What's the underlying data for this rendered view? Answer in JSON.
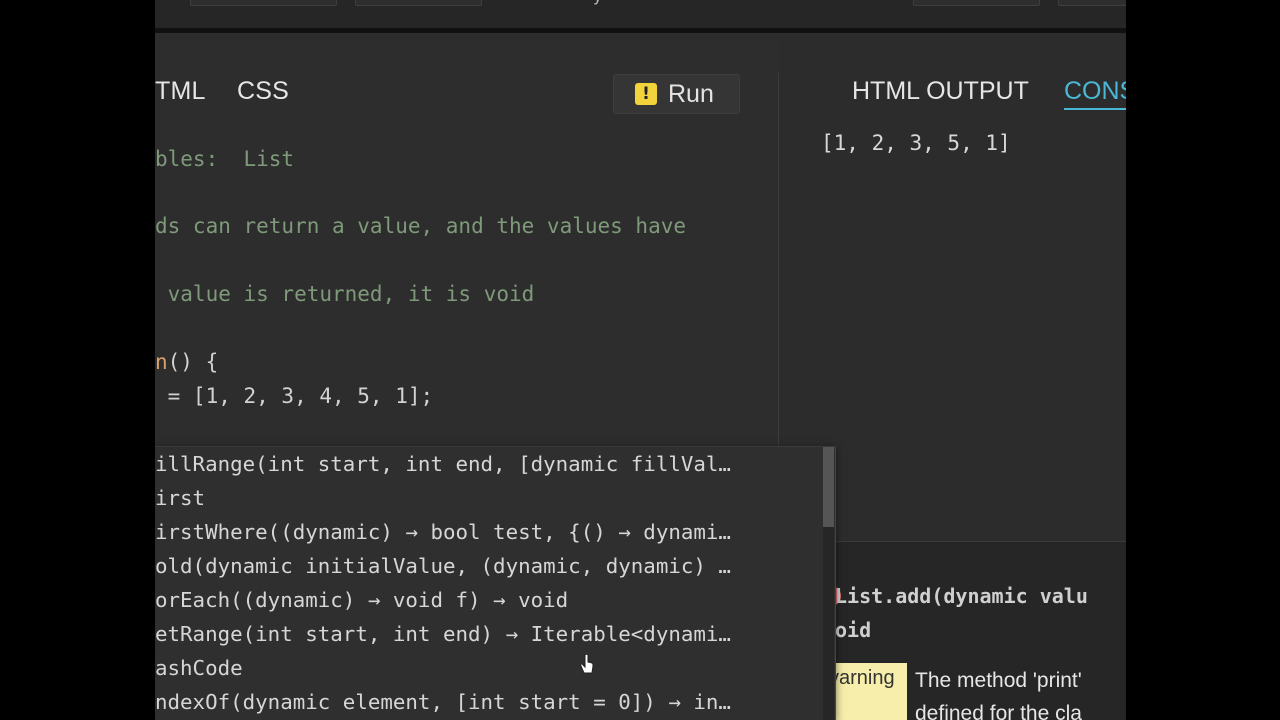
{
  "top_bar": {
    "partial_text": "y"
  },
  "editor": {
    "tabs": [
      "TML",
      "CSS"
    ],
    "run_label": "Run",
    "run_icon": "warning-exclamation-icon",
    "lines": [
      {
        "text": "bles:  List",
        "kind": "comment"
      },
      {
        "text": "ds can return a value, and the values have",
        "kind": "comment"
      },
      {
        "text": " value is returned, it is void",
        "kind": "comment"
      },
      {
        "text_fn": "n",
        "text_rest": "() {",
        "kind": "code"
      },
      {
        "text": " = [1, 2, 3, 4, 5, 1];",
        "kind": "code"
      }
    ]
  },
  "output": {
    "tabs": [
      "HTML OUTPUT",
      "CONS"
    ],
    "console_line": "[1, 2, 3, 5, 1]"
  },
  "problems": {
    "signature": "List.add(dynamic valu",
    "return_type": "oid",
    "badge": "varning",
    "message_line1": "The method 'print'",
    "message_line2": "defined for the cla"
  },
  "autocomplete": {
    "items": [
      "illRange(int start, int end, [dynamic fillVal…",
      "irst",
      "irstWhere((dynamic) → bool test, {() → dynami…",
      "old(dynamic initialValue, (dynamic, dynamic) …",
      "orEach((dynamic) → void f) → void",
      "etRange(int start, int end) → Iterable<dynami…",
      "ashCode",
      "ndexOf(dynamic element, [int start = 0]) → in…"
    ]
  },
  "colors": {
    "accent": "#4ab7d6",
    "run_icon": "#f2d33b",
    "comment": "#7f9a7a",
    "warning_badge": "#f6eeaa"
  }
}
